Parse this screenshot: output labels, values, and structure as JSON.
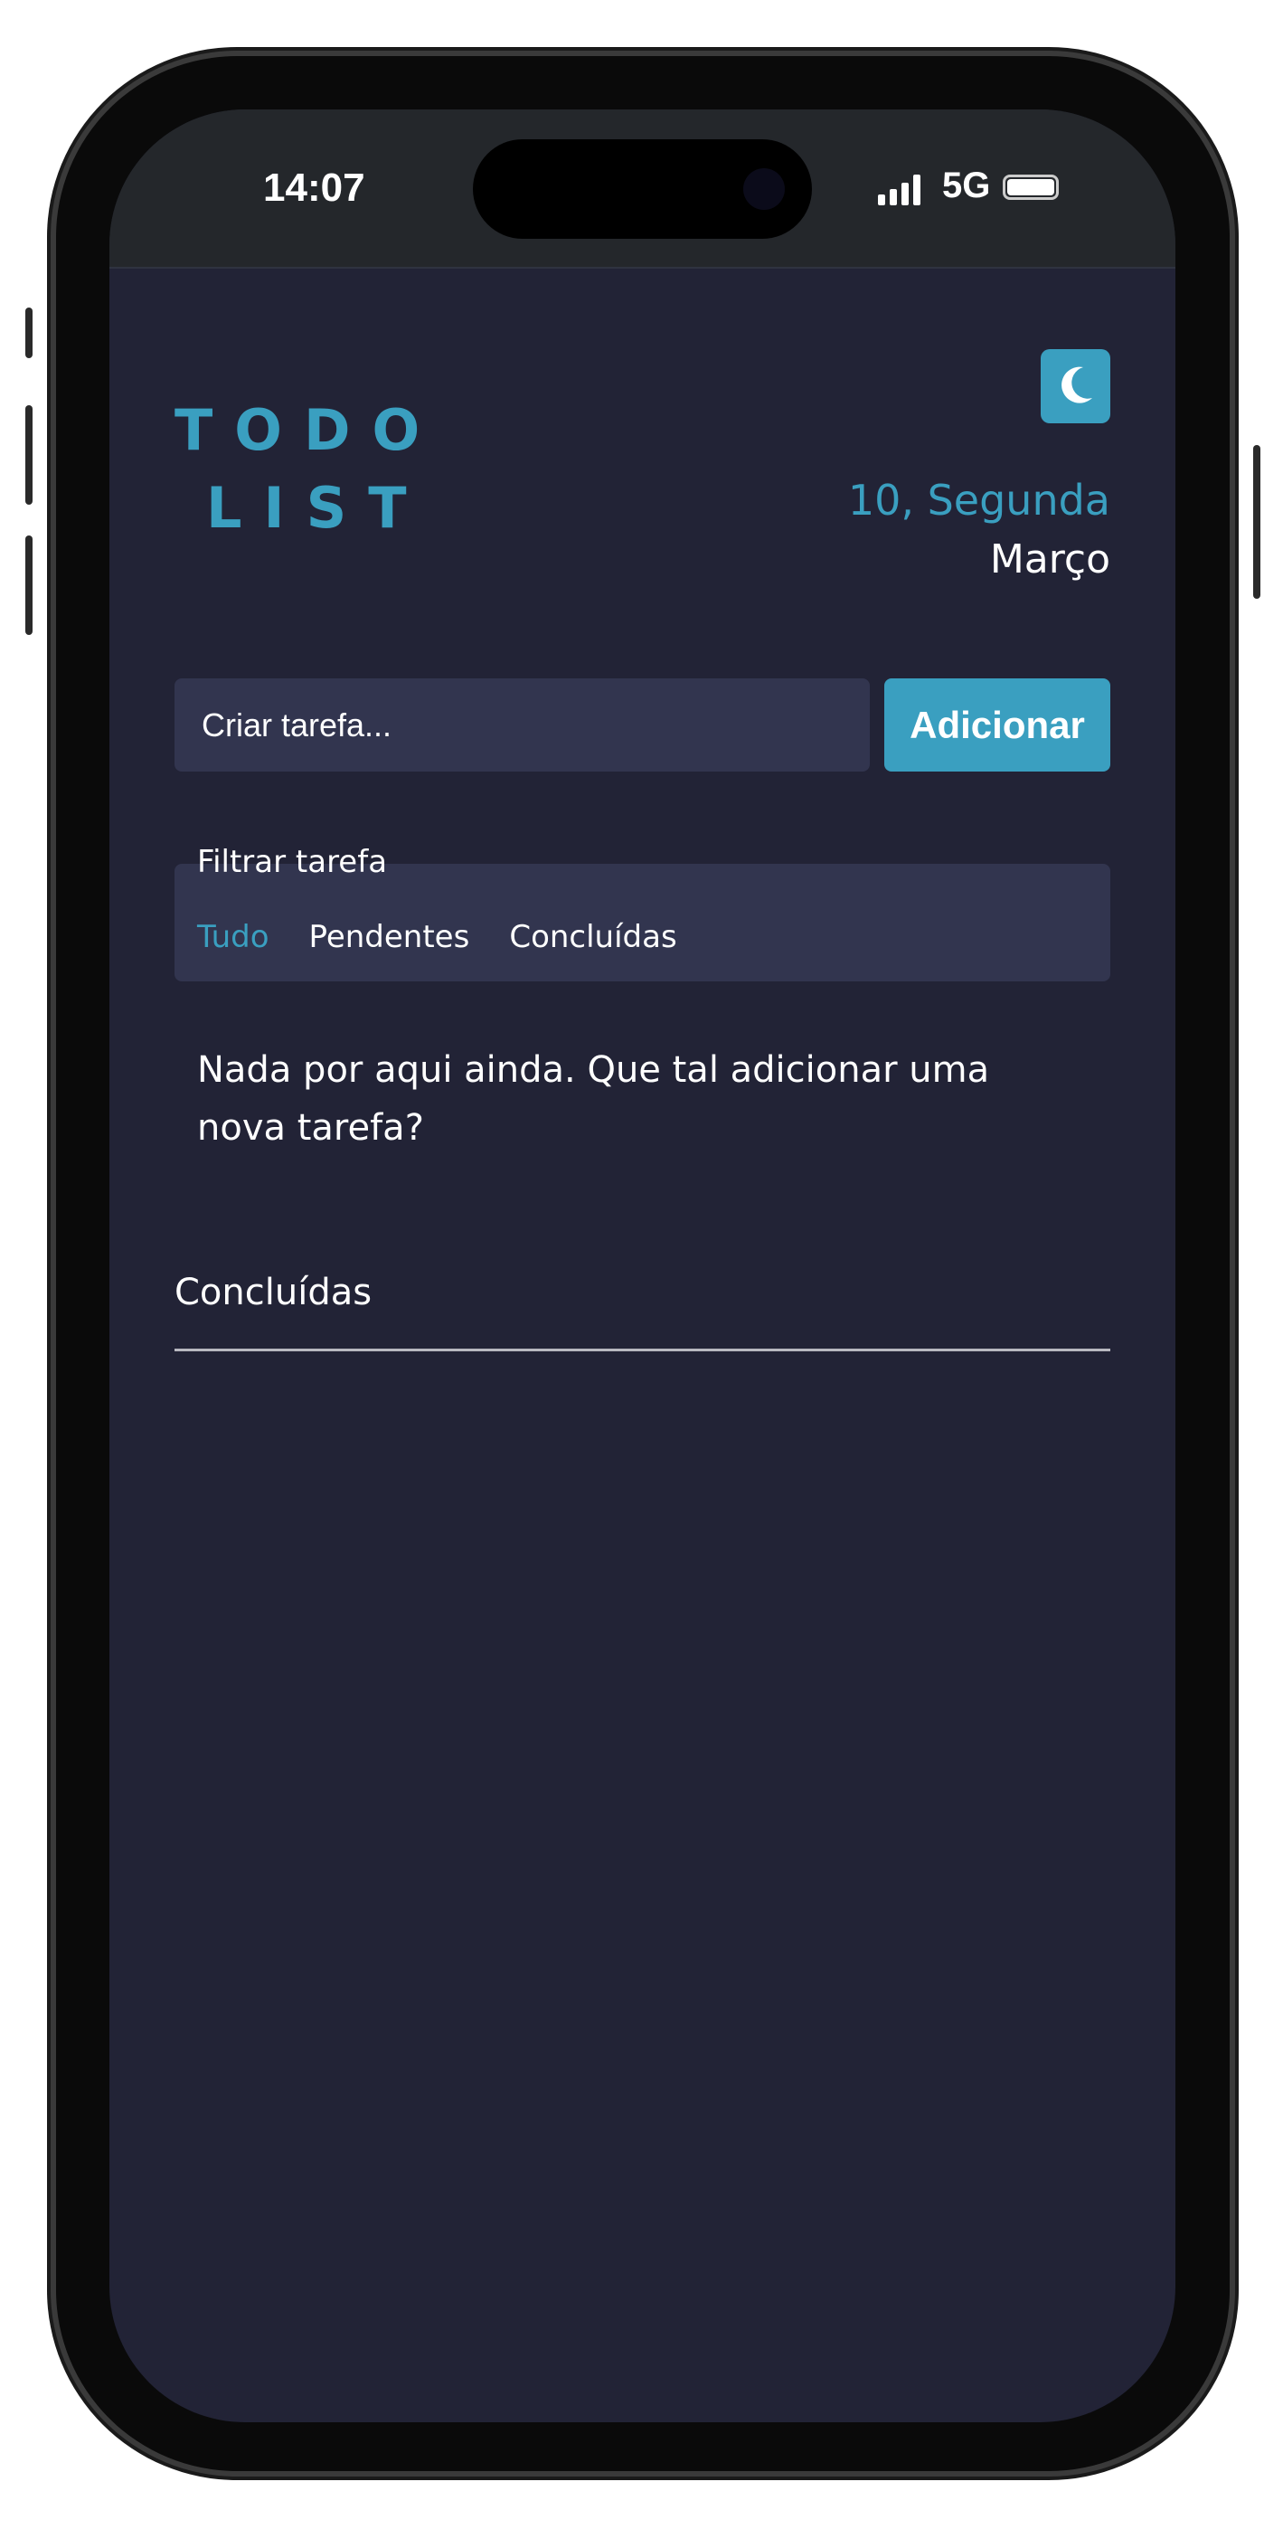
{
  "status_bar": {
    "time": "14:07",
    "network": "5G",
    "signal_icon": "signal-bars-icon",
    "battery_icon": "battery-icon"
  },
  "header": {
    "logo_line1": "TODO",
    "logo_line2": "LIST",
    "theme_toggle_icon": "moon-icon",
    "date_day": "10, Segunda",
    "date_month": "Março"
  },
  "task_form": {
    "placeholder": "Criar tarefa...",
    "add_label": "Adicionar"
  },
  "filter": {
    "label": "Filtrar tarefa",
    "options": [
      {
        "label": "Tudo",
        "active": true
      },
      {
        "label": "Pendentes",
        "active": false
      },
      {
        "label": "Concluídas",
        "active": false
      }
    ]
  },
  "empty_message": "Nada por aqui ainda. Que tal adicionar uma nova tarefa?",
  "completed_section": {
    "title": "Concluídas"
  },
  "colors": {
    "background": "#222336",
    "surface": "#32354f",
    "accent": "#3a9fc0",
    "status_bar": "#24272b"
  }
}
